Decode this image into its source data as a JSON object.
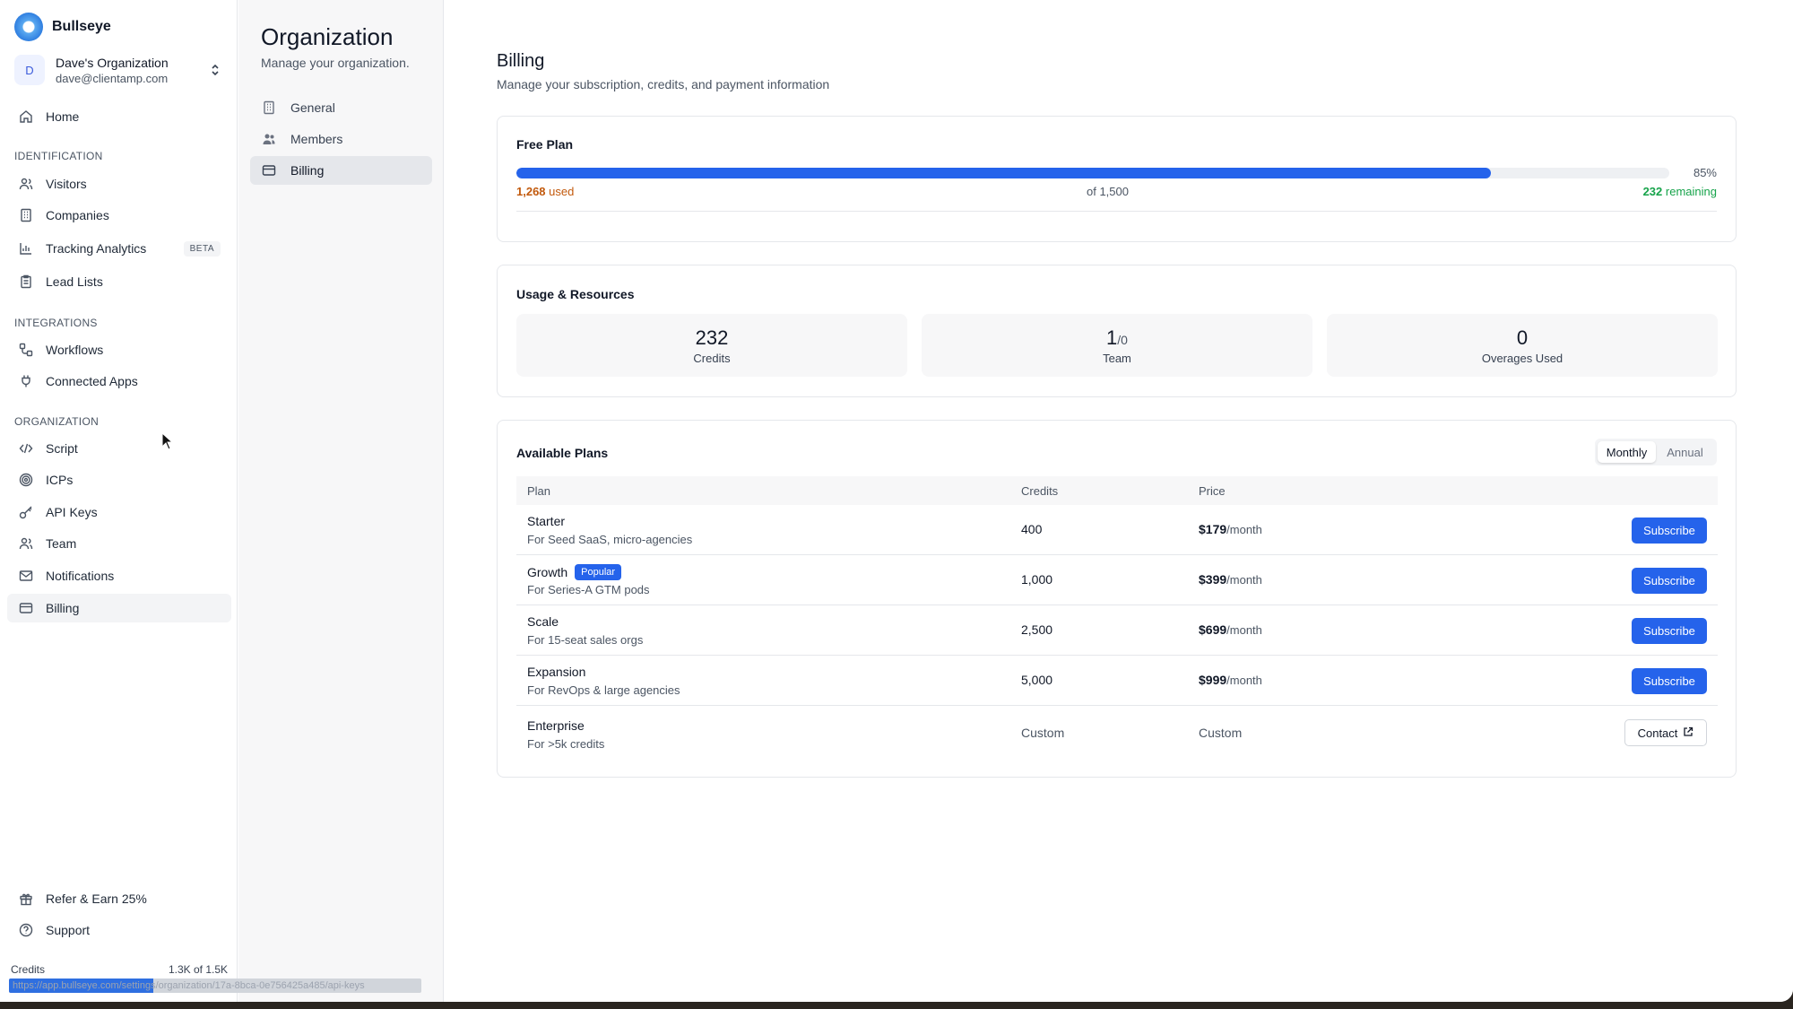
{
  "app": {
    "name": "Bullseye"
  },
  "org_switcher": {
    "initial": "D",
    "name": "Dave's Organization",
    "email": "dave@clientamp.com"
  },
  "sidebar": {
    "home": "Home",
    "sections": {
      "identification": "IDENTIFICATION",
      "integrations": "INTEGRATIONS",
      "organization": "ORGANIZATION"
    },
    "items": {
      "visitors": "Visitors",
      "companies": "Companies",
      "tracking": "Tracking Analytics",
      "tracking_badge": "BETA",
      "lead_lists": "Lead Lists",
      "workflows": "Workflows",
      "connected_apps": "Connected Apps",
      "script": "Script",
      "icps": "ICPs",
      "api_keys": "API Keys",
      "team": "Team",
      "notifications": "Notifications",
      "billing": "Billing",
      "refer": "Refer & Earn 25%",
      "support": "Support"
    },
    "footer": {
      "credits_label": "Credits",
      "credits_value": "1.3K of 1.5K",
      "credits_fraction": 0.35
    },
    "status_url": "https://app.bullseye.com/settings/organization/17a-8bca-0e756425a485/api-keys"
  },
  "org_pane": {
    "title": "Organization",
    "subtitle": "Manage your organization.",
    "items": {
      "general": "General",
      "members": "Members",
      "billing": "Billing"
    }
  },
  "billing": {
    "title": "Billing",
    "subtitle": "Manage your subscription, credits, and payment information",
    "plan": {
      "name": "Free Plan",
      "percent_label": "85%",
      "used_fraction": 0.845,
      "used_number": "1,268",
      "used_word": "used",
      "total": "of 1,500",
      "remaining_number": "232",
      "remaining_word": "remaining"
    },
    "usage": {
      "title": "Usage & Resources",
      "credits_value": "232",
      "credits_label": "Credits",
      "team_value": "1",
      "team_suffix": "/0",
      "team_label": "Team",
      "overages_value": "0",
      "overages_label": "Overages Used"
    },
    "plans": {
      "title": "Available Plans",
      "toggle": {
        "monthly": "Monthly",
        "annual": "Annual"
      },
      "headers": {
        "plan": "Plan",
        "credits": "Credits",
        "price": "Price"
      },
      "per_month": "/month",
      "rows": [
        {
          "name": "Starter",
          "desc": "For Seed SaaS, micro-agencies",
          "credits": "400",
          "price": "$179",
          "action": "Subscribe"
        },
        {
          "name": "Growth",
          "badge": "Popular",
          "desc": "For Series-A GTM pods",
          "credits": "1,000",
          "price": "$399",
          "action": "Subscribe"
        },
        {
          "name": "Scale",
          "desc": "For 15-seat sales orgs",
          "credits": "2,500",
          "price": "$699",
          "action": "Subscribe"
        },
        {
          "name": "Expansion",
          "desc": "For RevOps & large agencies",
          "credits": "5,000",
          "price": "$999",
          "action": "Subscribe"
        },
        {
          "name": "Enterprise",
          "desc": "For >5k credits",
          "credits": "Custom",
          "price": "Custom",
          "action": "Contact"
        }
      ]
    }
  }
}
